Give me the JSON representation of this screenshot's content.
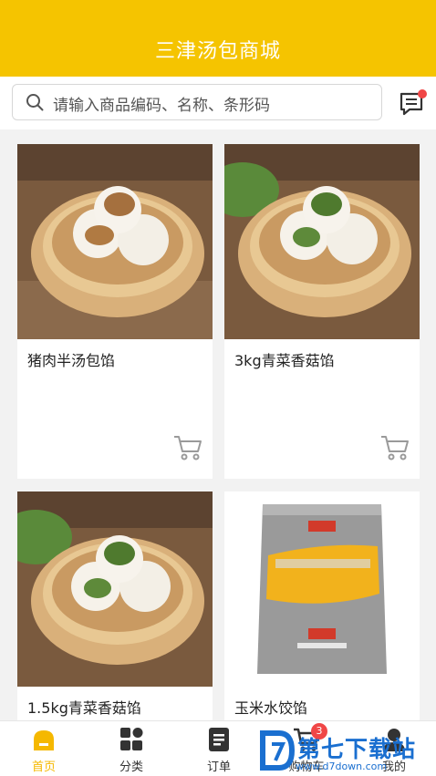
{
  "header": {
    "title": "三津汤包商城"
  },
  "search": {
    "placeholder": "请输入商品编码、名称、条形码"
  },
  "products": [
    {
      "name": "猪肉半汤包馅"
    },
    {
      "name": "3kg青菜香菇馅"
    },
    {
      "name": "1.5kg青菜香菇馅"
    },
    {
      "name": "玉米水饺馅"
    }
  ],
  "tabbar": {
    "items": [
      {
        "label": "首页"
      },
      {
        "label": "分类"
      },
      {
        "label": "订单"
      },
      {
        "label": "购物车",
        "badge": "3"
      },
      {
        "label": "我的"
      }
    ]
  },
  "watermark": {
    "text": "第七下载站",
    "url": "www.d7down.com"
  },
  "colors": {
    "brand": "#f5c400",
    "badge": "#f04646"
  }
}
